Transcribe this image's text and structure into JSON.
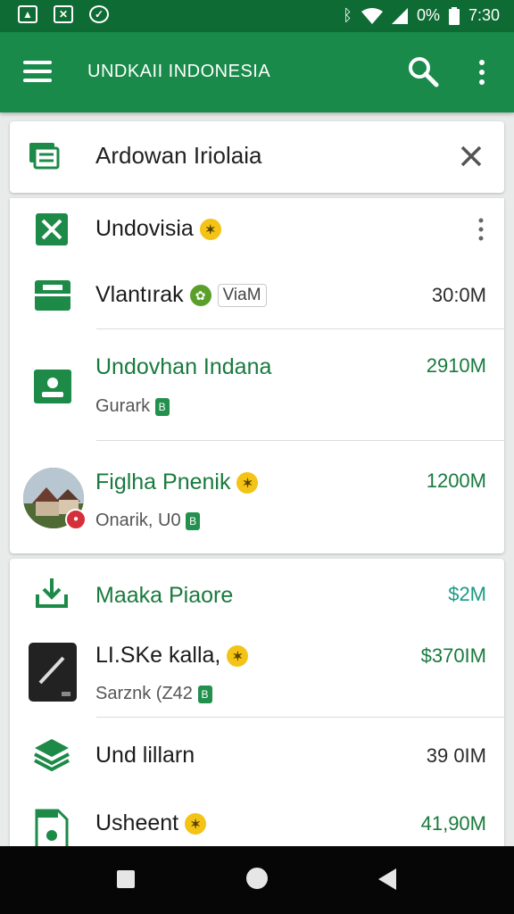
{
  "status_bar": {
    "battery": "0%",
    "time": "7:30",
    "icons": [
      "gallery-icon",
      "no-signal-icon",
      "compass-icon",
      "bluetooth-icon",
      "wifi-icon",
      "cell-signal-icon",
      "battery-icon"
    ]
  },
  "app_bar": {
    "title": "UNDKAII INDONESIA",
    "icons": [
      "menu-icon",
      "search-icon",
      "more-vert-icon"
    ]
  },
  "search_card": {
    "text": "Ardowan Iriolaia",
    "icons": [
      "list-icon",
      "close-icon"
    ]
  },
  "list_card_1": {
    "items": [
      {
        "name": "Undovisia",
        "badge": "✶",
        "icon": "check-box-icon"
      },
      {
        "name": "Vlantırak",
        "chip": "ViaM",
        "amount": "30:0M",
        "icon": "id-card-icon"
      },
      {
        "name": "Undovhan Indana",
        "sub": "Gurark",
        "amount": "2910M",
        "icon": "contact-card-icon"
      },
      {
        "name": "Figlha Pnenik",
        "sub": "Onarik, U0",
        "amount": "1200M",
        "avatar_badge": "●",
        "icon": "house-photo-avatar"
      }
    ]
  },
  "list_card_2": {
    "items": [
      {
        "name": "Maaka Piaore",
        "amount": "$2M",
        "icon": "download-icon"
      },
      {
        "name": "LI.SKe kalla,",
        "sub": "Sarznk (Z42",
        "amount": "$370IM",
        "icon": "device-thumb-icon"
      },
      {
        "name": "Und lillarn",
        "amount": "39 0IM",
        "icon": "layers-icon"
      },
      {
        "name": "Usheent",
        "amount": "41,90M",
        "icon": "media-file-icon"
      }
    ]
  },
  "nav_bar": {
    "icons": [
      "recent-apps-icon",
      "home-icon",
      "back-icon"
    ]
  },
  "colors": {
    "status_bar": "#0f6b34",
    "app_bar": "#198a4a",
    "accent_green": "#197a3e",
    "badge_yellow": "#f3c316"
  }
}
